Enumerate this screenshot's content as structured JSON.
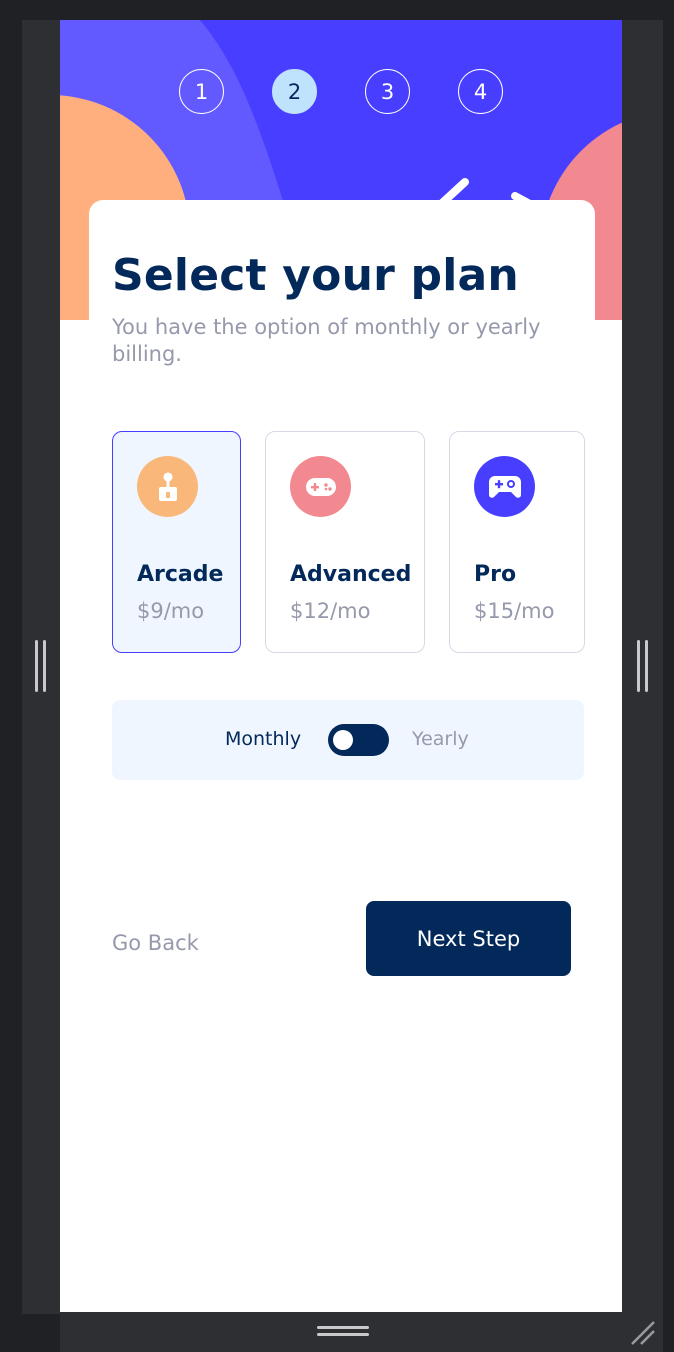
{
  "steps": [
    "1",
    "2",
    "3",
    "4"
  ],
  "active_step": "2",
  "form": {
    "title": "Select your plan",
    "subtitle": "You have the option of monthly or yearly billing."
  },
  "plans": [
    {
      "name": "Arcade",
      "price": "$9/mo",
      "icon": "arcade-joystick-icon",
      "color": "#f9b77a",
      "selected": true
    },
    {
      "name": "Advanced",
      "price": "$12/mo",
      "icon": "gamepad-icon",
      "color": "#f38990",
      "selected": false
    },
    {
      "name": "Pro",
      "price": "$15/mo",
      "icon": "controller-icon",
      "color": "#483eff",
      "selected": false
    }
  ],
  "billing": {
    "monthly_label": "Monthly",
    "yearly_label": "Yearly",
    "selected": "Monthly"
  },
  "actions": {
    "back_label": "Go Back",
    "next_label": "Next Step"
  },
  "colors": {
    "marine_blue": "#02295a",
    "purplish_blue": "#483eff",
    "light_blue": "#bfe2fd",
    "cool_gray": "#9699ab",
    "magnolia": "#f0f6ff"
  }
}
